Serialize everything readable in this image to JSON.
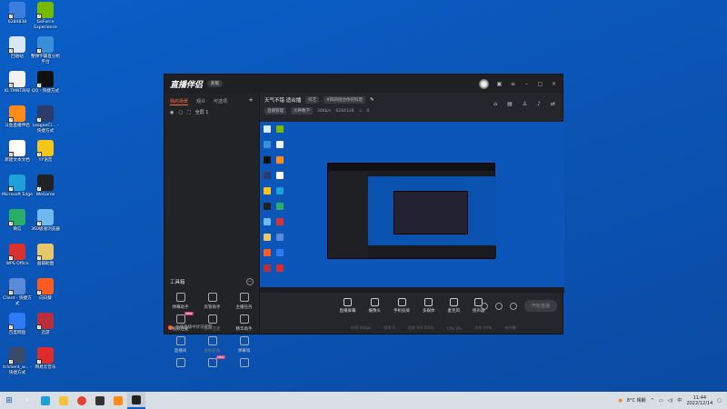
{
  "desktop": {
    "icons": [
      {
        "label": "6284838",
        "color": "#3c7ee0"
      },
      {
        "label": "GeForce Experience",
        "color": "#76b900"
      },
      {
        "label": "回收站",
        "color": "#d9e6f5"
      },
      {
        "label": "整弹学霸直分析平台",
        "color": "#3a8fd8"
      },
      {
        "label": "IG TMNT商号",
        "color": "#f2f2f2"
      },
      {
        "label": "QQ - 快捷方式",
        "color": "#111111"
      },
      {
        "label": "斗鱼直播伴侣",
        "color": "#ff8c1a"
      },
      {
        "label": "LeagueCl... - 快捷方式",
        "color": "#2a3d6a"
      },
      {
        "label": "新建文本文档",
        "color": "#ffffff"
      },
      {
        "label": "YY语音",
        "color": "#f5c518"
      },
      {
        "label": "Microsoft Edge",
        "color": "#1ea0d8"
      },
      {
        "label": "WeGame",
        "color": "#222222"
      },
      {
        "label": "微信",
        "color": "#2aae67"
      },
      {
        "label": "360极速浏览器",
        "color": "#6fb8f0"
      },
      {
        "label": "WPS Office",
        "color": "#d9322e"
      },
      {
        "label": "画辅助图",
        "color": "#e8c66a"
      },
      {
        "label": "Client - 快捷方式",
        "color": "#5a8ad9"
      },
      {
        "label": "向日葵",
        "color": "#ff5a1f"
      },
      {
        "label": "百度网盘",
        "color": "#2f7bf5"
      },
      {
        "label": "迅游",
        "color": "#b92e3a"
      },
      {
        "label": "tclsSent_w... - 快捷方式",
        "color": "#3a4b6a"
      },
      {
        "label": "网易云音乐",
        "color": "#e02b2b"
      }
    ]
  },
  "window": {
    "logo": "直播伴侣",
    "version": "新版",
    "left_tabs": [
      "我的场景",
      "观众",
      "可选项"
    ],
    "scene_label": "全屏 1",
    "tools_title": "工具箱",
    "tools": [
      {
        "label": "弹幕助手",
        "icon": "danmaku-icon"
      },
      {
        "label": "房管助手",
        "icon": "admin-icon"
      },
      {
        "label": "主播任务",
        "icon": "task-icon"
      },
      {
        "label": "视频连麦",
        "icon": "video-link-icon",
        "badge": "NEW"
      },
      {
        "label": "多人连麦",
        "icon": "multi-link-icon",
        "dim": true
      },
      {
        "label": "精华助手",
        "icon": "highlight-icon"
      },
      {
        "label": "直播间",
        "icon": "room-icon"
      },
      {
        "label": "虚拟形象",
        "icon": "avatar-icon",
        "dim": true
      },
      {
        "label": "弹幕墙",
        "icon": "wall-icon"
      },
      {
        "label": "",
        "icon": "extra-icon"
      },
      {
        "label": "",
        "icon": "new-tool-icon",
        "badge": "NEW"
      },
      {
        "label": "",
        "icon": "download-icon"
      }
    ],
    "footer": "主播直播中状况提醒",
    "info": {
      "title": "天气不错 适合播",
      "category": "综艺",
      "tag": "#四四组合你的科普",
      "room_label": "直播管理",
      "room_name": "大神教学",
      "kbps": "30Kb/s",
      "room_id": "6284138",
      "count": "0"
    },
    "controls": [
      {
        "label": "直播屏幕",
        "icon": "screen-icon"
      },
      {
        "label": "摄像头",
        "icon": "camera-icon"
      },
      {
        "label": "手机投屏",
        "icon": "phone-cast-icon"
      },
      {
        "label": "多媒体",
        "icon": "media-icon"
      },
      {
        "label": "麦克风",
        "icon": "mic-icon"
      },
      {
        "label": "扬声器",
        "icon": "speaker-icon"
      }
    ],
    "start_button": "开始直播",
    "status": [
      "码率 0kbps",
      "帧率 0",
      "丢帧 0(0.00%)",
      "CPU 4%",
      "内存 44%",
      "未开播"
    ]
  },
  "taskbar": {
    "weather": "8°C 晴朗",
    "time": "11:44",
    "date": "2022/12/14"
  }
}
